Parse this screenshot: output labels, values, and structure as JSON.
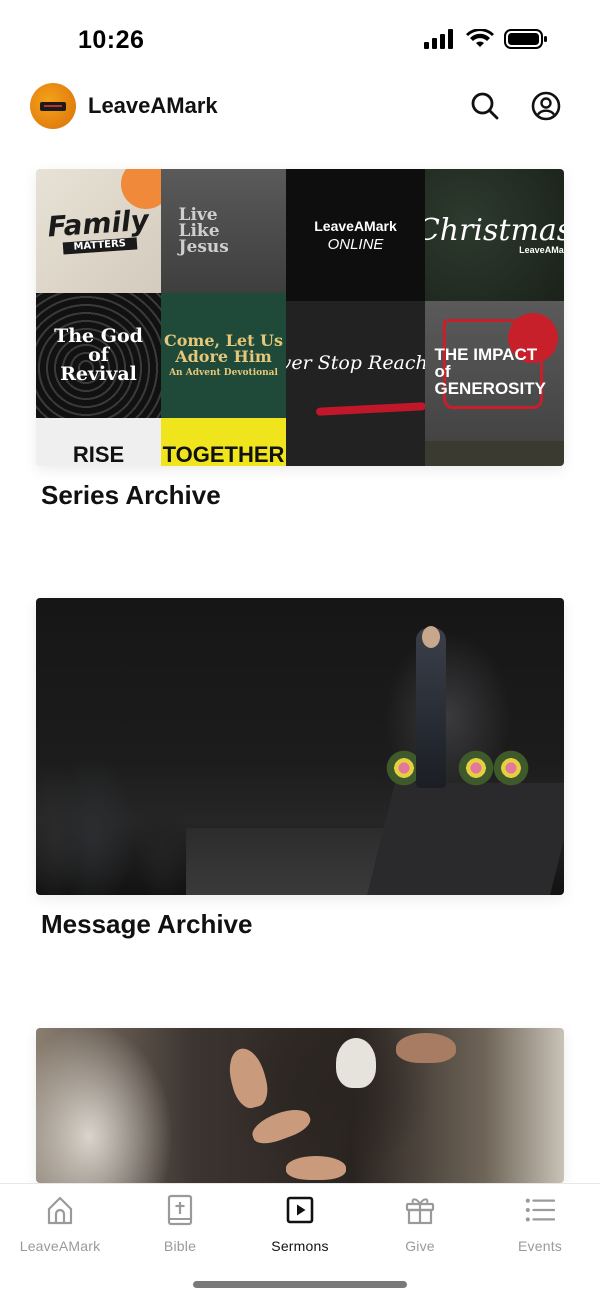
{
  "status_bar": {
    "time": "10:26"
  },
  "header": {
    "app_title": "LeaveAMark"
  },
  "cards": [
    {
      "title": "Series Archive",
      "collage": {
        "family": "Family",
        "family_sub": "MATTERS",
        "live": "Live Like Jesus",
        "brand": "LeaveAMark",
        "online": "ONLINE",
        "christmas": "Christmas",
        "christmas_brand": "LeaveAMark",
        "god": "The God of Revival",
        "come": "Come, Let Us Adore Him",
        "advent": "An Advent Devotional",
        "never": "Never Stop Reaching",
        "impact": "THE IMPACT of GENEROSITY",
        "peek": "RISE",
        "together": "TOGETHER"
      }
    },
    {
      "title": "Message Archive"
    },
    {
      "title": ""
    }
  ],
  "bottom_nav": [
    {
      "label": "LeaveAMark",
      "icon": "church-icon"
    },
    {
      "label": "Bible",
      "icon": "bible-icon"
    },
    {
      "label": "Sermons",
      "icon": "play-square-icon",
      "active": true
    },
    {
      "label": "Give",
      "icon": "gift-icon"
    },
    {
      "label": "Events",
      "icon": "list-icon"
    }
  ]
}
